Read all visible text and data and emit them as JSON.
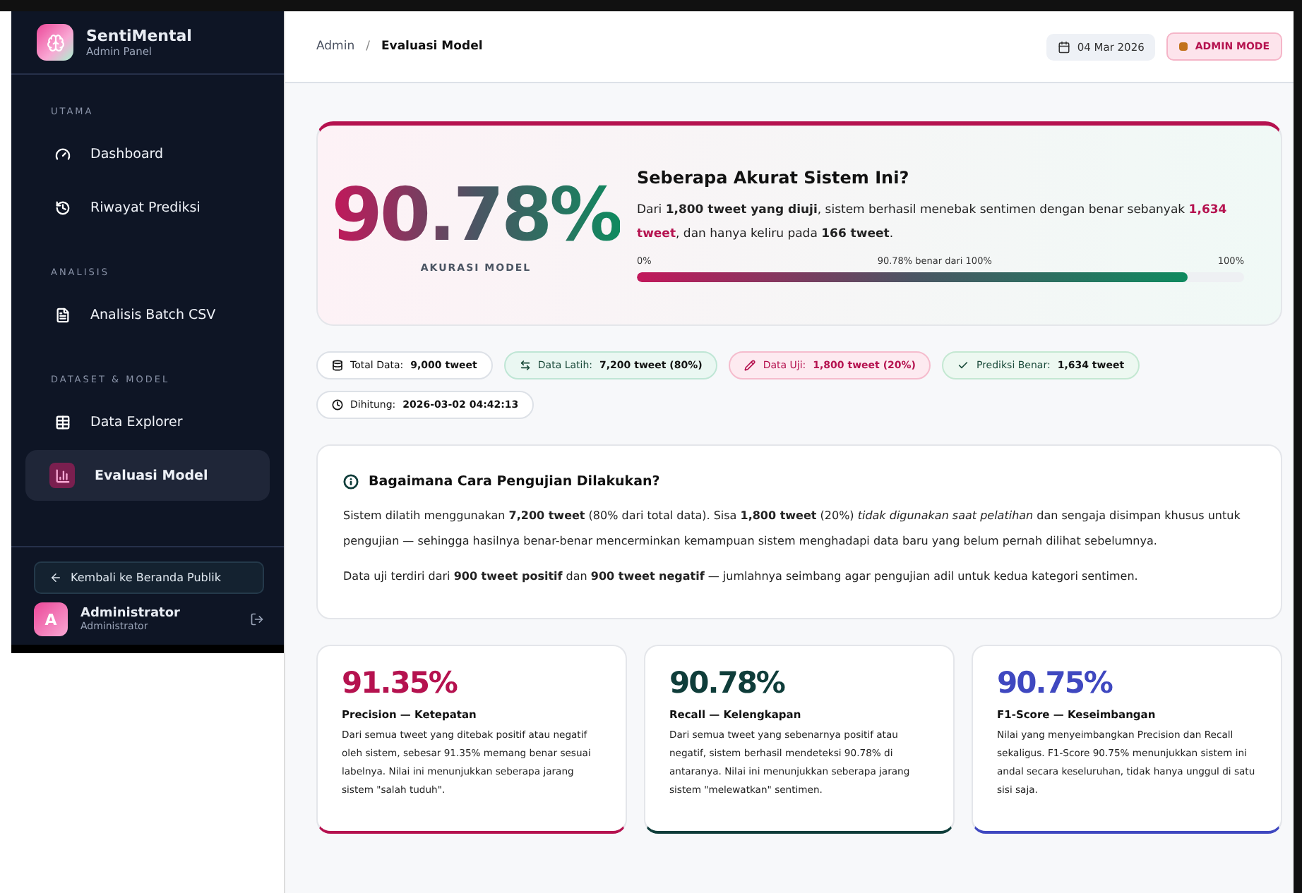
{
  "sidebar": {
    "brand": {
      "name": "SentiMental",
      "subtitle": "Admin Panel"
    },
    "sections": [
      {
        "label": "UTAMA",
        "items": [
          {
            "label": "Dashboard",
            "selected": false
          },
          {
            "label": "Riwayat Prediksi",
            "selected": false
          }
        ]
      },
      {
        "label": "ANALISIS",
        "items": [
          {
            "label": "Analisis Batch CSV",
            "selected": false
          }
        ]
      },
      {
        "label": "DATASET & MODEL",
        "items": [
          {
            "label": "Data Explorer",
            "selected": false
          },
          {
            "label": "Evaluasi Model",
            "selected": true
          }
        ]
      }
    ],
    "back_button": "Kembali ke Beranda Publik",
    "user": {
      "avatar": "A",
      "name": "Administrator",
      "role": "Administrator"
    }
  },
  "header": {
    "breadcrumb": [
      "Admin",
      "Evaluasi Model"
    ],
    "breadcrumb_separator": "/",
    "date": "04 Mar 2026",
    "mode_badge": "ADMIN MODE"
  },
  "hero": {
    "accuracy": "90.78%",
    "accuracy_label": "AKURASI MODEL",
    "title": "Seberapa Akurat Sistem Ini?",
    "text": "Dari **1,800 tweet yang diuji**, sistem berhasil menebak sentimen dengan benar sebanyak *1,634 tweet*, dan hanya keliru pada **166 tweet**.",
    "progress": {
      "min_label": "0%",
      "center_label": "90.78% benar dari 100%",
      "max_label": "100%",
      "level": 0.9078
    }
  },
  "chips": [
    {
      "kind": "neutral",
      "label": "Total Data:",
      "value": "9,000 tweet"
    },
    {
      "kind": "train",
      "label": "Data Latih:",
      "value": "7,200 tweet (80%)"
    },
    {
      "kind": "test",
      "label": "Data Uji:",
      "value": "1,800 tweet (20%)"
    },
    {
      "kind": "correct",
      "label": "Prediksi Benar:",
      "value": "1,634 tweet"
    },
    {
      "kind": "neutral",
      "label": "Dihitung:",
      "value": "2026-03-02 04:42:13"
    }
  ],
  "info": {
    "title": "Bagaimana Cara Pengujian Dilakukan?",
    "paragraphs": [
      "Sistem dilatih menggunakan **7,200 tweet** (80% dari total data). Sisa **1,800 tweet** (20%) *tidak digunakan saat pelatihan* dan sengaja disimpan khusus untuk pengujian — sehingga hasilnya benar-benar mencerminkan kemampuan sistem menghadapi data baru yang belum pernah dilihat sebelumnya.",
      "Data uji terdiri dari **900 tweet positif** dan **900 tweet negatif** — jumlahnya seimbang agar pengujian adil untuk kedua kategori sentimen."
    ]
  },
  "metrics": [
    {
      "value": "91.35%",
      "title": "Precision — Ketepatan",
      "color": "#b5124f",
      "text": "Dari semua tweet yang ditebak positif atau negatif oleh sistem, sebesar 91.35% memang benar sesuai labelnya. Nilai ini menunjukkan seberapa jarang sistem \"salah tuduh\"."
    },
    {
      "value": "90.78%",
      "title": "Recall — Kelengkapan",
      "color": "#0f3d3a",
      "text": "Dari semua tweet yang sebenarnya positif atau negatif, sistem berhasil mendeteksi 90.78% di antaranya. Nilai ini menunjukkan seberapa jarang sistem \"melewatkan\" sentimen."
    },
    {
      "value": "90.75%",
      "title": "F1-Score — Keseimbangan",
      "color": "#3f48c0",
      "text": "Nilai yang menyeimbangkan Precision dan Recall sekaligus. F1-Score 90.75% menunjukkan sistem ini andal secara keseluruhan, tidak hanya unggul di satu sisi saja."
    }
  ]
}
